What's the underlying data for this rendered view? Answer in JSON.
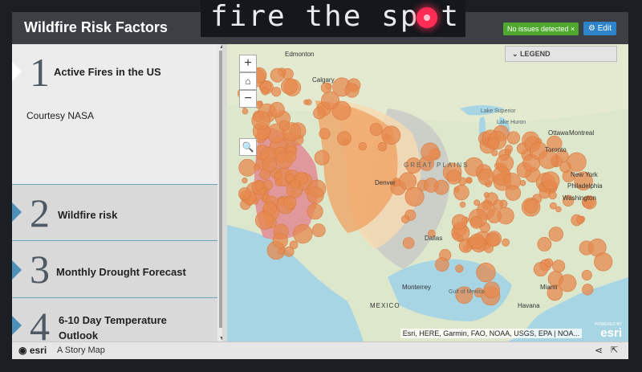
{
  "brand": {
    "text_before": "fire the sp",
    "text_after": "t"
  },
  "header": {
    "title": "Wildfire Risk Factors",
    "issues_badge": "No issues detected ×",
    "edit_label": "Edit"
  },
  "sidebar": {
    "entries": [
      {
        "number": "1",
        "title": "Active Fires in the US",
        "credit": "Courtesy NASA"
      },
      {
        "number": "2",
        "title": "Wildfire risk"
      },
      {
        "number": "3",
        "title": "Monthly Drought Forecast"
      },
      {
        "number": "4",
        "title": "6-10 Day Temperature Outlook"
      }
    ]
  },
  "map": {
    "zoom_in": "+",
    "zoom_out": "−",
    "home_icon": "home-icon",
    "search_icon": "search-icon",
    "legend_label": "LEGEND",
    "attribution": "Esri, HERE, Garmin, FAO, NOAA, USGS, EPA | NOA...",
    "esri_logo": "esri",
    "esri_logo_small": "POWERED BY",
    "labels": {
      "edmonton": "Edmonton",
      "calgary": "Calgary",
      "ottawa": "Ottawa",
      "montreal": "Montreal",
      "toronto": "Toronto",
      "new_york": "New York",
      "philadelphia": "Philadelphia",
      "washington": "Washington",
      "denver": "Denver",
      "dallas": "Dallas",
      "monterrey": "Monterrey",
      "miami": "Miami",
      "havana": "Havana",
      "mexico": "MEXICO",
      "great_plains": "GREAT PLAINS",
      "lake_superior": "Lake Superior",
      "lake_huron": "Lake Huron",
      "gulf_of_mexico": "Gulf of Mexico"
    },
    "fire_color": "#e6894f",
    "risk_colors": [
      "#e07e8a",
      "#f0a060",
      "#f7d9b0",
      "#c4c4c4"
    ]
  },
  "footer": {
    "logo": "esri",
    "caption": "A Story Map"
  }
}
